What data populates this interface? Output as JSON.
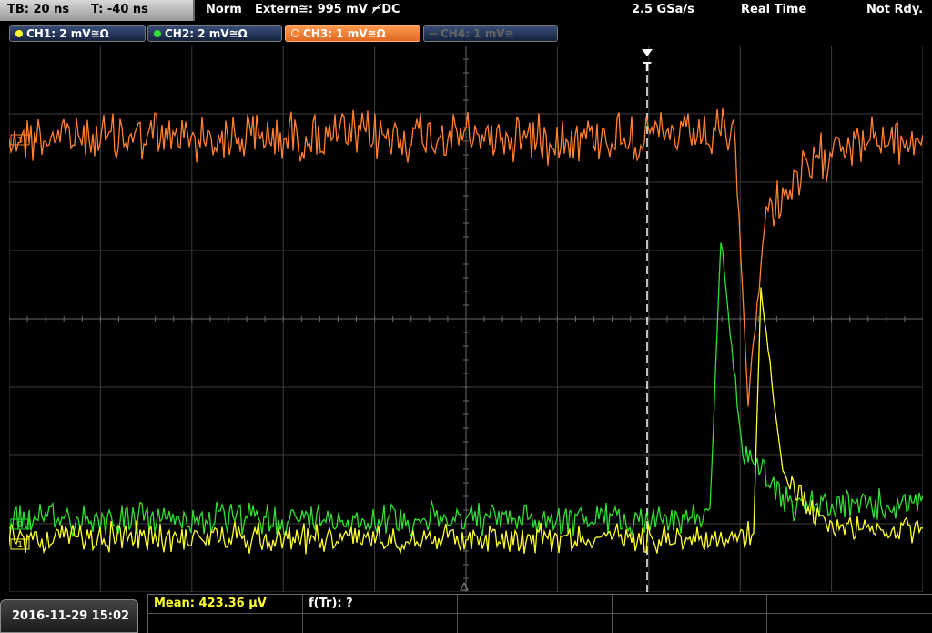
{
  "header": {
    "timebase": "TB: 20 ns",
    "trigger_time": "T: -40 ns",
    "trigger_mode": "Norm",
    "trigger_source": "Extern≅: 995 mV ⌐̸DC",
    "sample_rate": "2.5 GSa/s",
    "acq_mode": "Real Time",
    "run_state": "Not Rdy."
  },
  "channels": [
    {
      "label": "CH1: 2 mV≅Ω",
      "color": "#ffff30",
      "state": "on"
    },
    {
      "label": "CH2: 2 mV≅Ω",
      "color": "#30e030",
      "state": "on"
    },
    {
      "label": "CH3: 1 mV≅Ω",
      "color": "#ff8030",
      "state": "active"
    },
    {
      "label": "CH4: 1 mV≅",
      "color": "#666666",
      "state": "off"
    }
  ],
  "markers": {
    "trigger_label": "T",
    "ch3_marker": "3",
    "ch2_marker": "2",
    "ch1_marker": "1"
  },
  "footer": {
    "datetime": "2016-11-29 15:02",
    "measurement_1": "Mean: 423.36 µV",
    "measurement_2": "f(Tr): ?"
  },
  "colors": {
    "ch1": "#ffff30",
    "ch2": "#30e030",
    "ch3": "#ff8030",
    "grid": "#505050"
  }
}
